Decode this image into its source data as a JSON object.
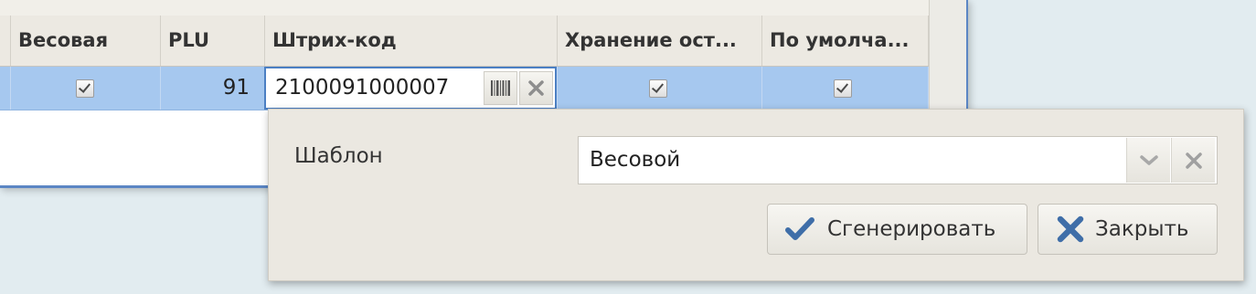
{
  "grid": {
    "columns": [
      {
        "key": "weight",
        "label": "Весовая"
      },
      {
        "key": "plu",
        "label": "PLU"
      },
      {
        "key": "barcode",
        "label": "Штрих-код"
      },
      {
        "key": "storage",
        "label": "Хранение ост..."
      },
      {
        "key": "default",
        "label": "По умолча..."
      }
    ],
    "row": {
      "weight_checked": true,
      "plu": "91",
      "barcode": "2100091000007",
      "storage_checked": true,
      "default_checked": true
    }
  },
  "barcode_editor": {
    "icons": [
      "barcode-icon",
      "clear-icon"
    ]
  },
  "popup": {
    "template_label": "Шаблон",
    "template_value": "Весовой",
    "combo_icons": [
      "chevron-down-icon",
      "clear-icon"
    ],
    "generate_button": "Сгенерировать",
    "close_button": "Закрыть",
    "colors": {
      "check_icon": "#3f6ea8",
      "close_icon": "#3f6ea8"
    }
  }
}
